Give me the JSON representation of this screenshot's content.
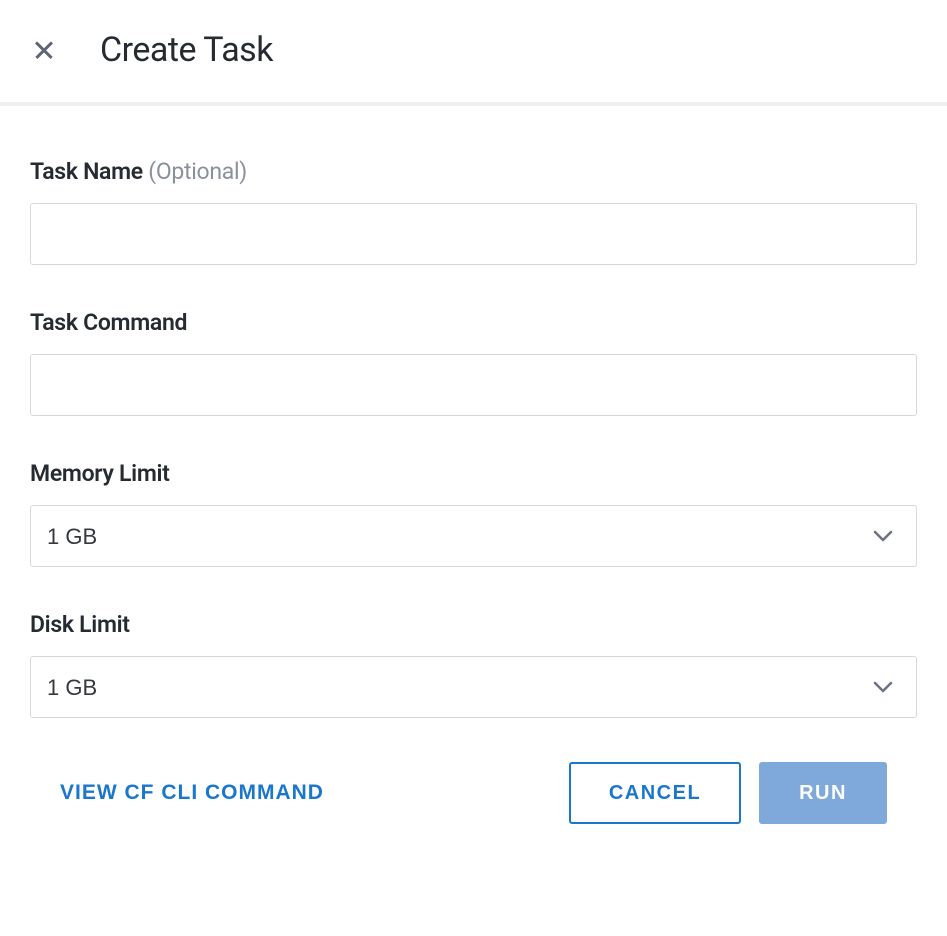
{
  "header": {
    "title": "Create Task"
  },
  "form": {
    "taskName": {
      "label": "Task Name",
      "optionalText": "(Optional)",
      "value": ""
    },
    "taskCommand": {
      "label": "Task Command",
      "value": ""
    },
    "memoryLimit": {
      "label": "Memory Limit",
      "value": "1 GB"
    },
    "diskLimit": {
      "label": "Disk Limit",
      "value": "1 GB"
    }
  },
  "footer": {
    "viewCliLabel": "VIEW CF CLI COMMAND",
    "cancelLabel": "CANCEL",
    "runLabel": "RUN"
  }
}
